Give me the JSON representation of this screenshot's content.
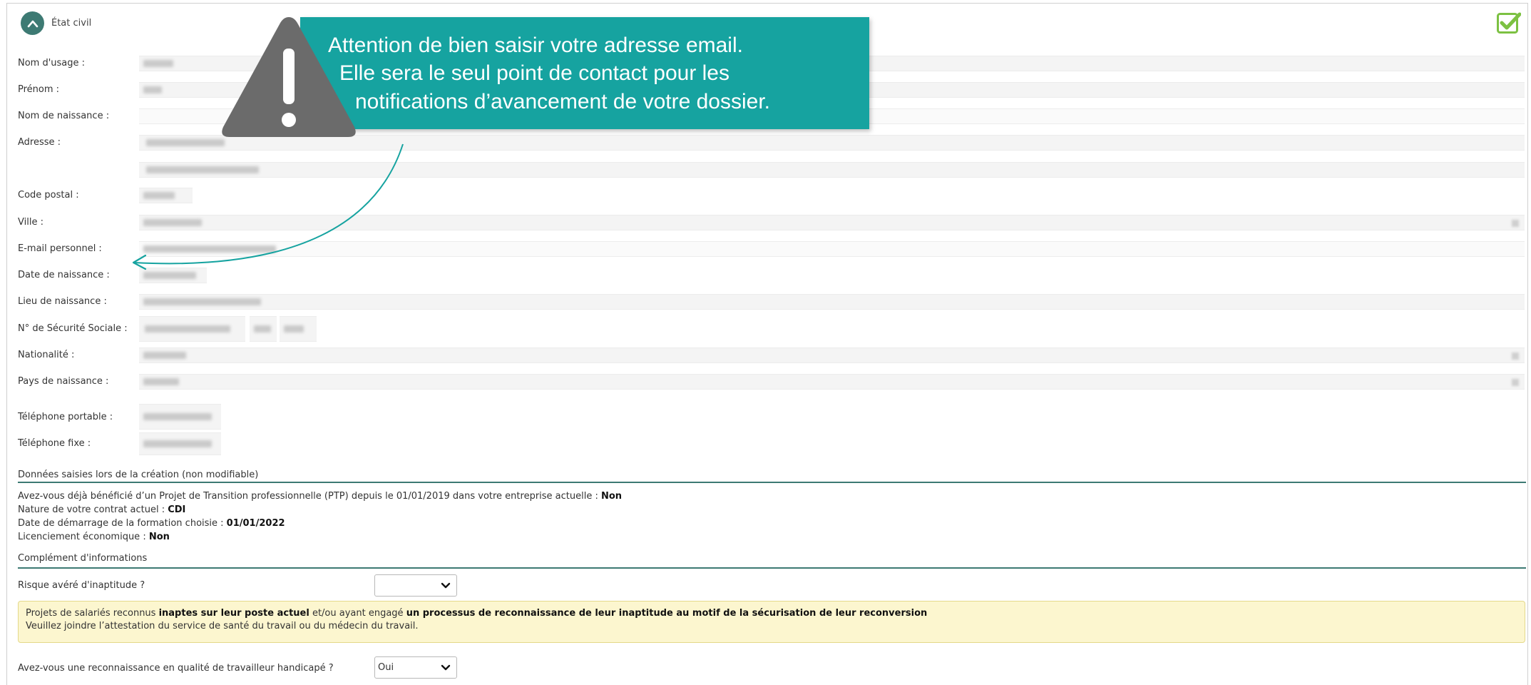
{
  "section": {
    "title": "État civil"
  },
  "labels": {
    "nom_usage": "Nom d'usage :",
    "prenom": "Prénom :",
    "nom_naissance": "Nom de naissance :",
    "adresse": "Adresse :",
    "code_postal": "Code postal :",
    "ville": "Ville :",
    "email": "E-mail personnel :",
    "date_naissance": "Date de naissance :",
    "lieu_naissance": "Lieu de naissance :",
    "secu": "N° de Sécurité Sociale :",
    "nationalite": "Nationalité :",
    "pays_naissance": "Pays de naissance :",
    "tel_portable": "Téléphone portable :",
    "tel_fixe": "Téléphone fixe :"
  },
  "creation": {
    "title": "Données saisies lors de la création (non modifiable)",
    "ptp_question": "Avez-vous déjà bénéficié d’un Projet de Transition professionnelle (PTP) depuis le 01/01/2019 dans votre entreprise actuelle : ",
    "ptp_value": "Non",
    "contrat_label": "Nature de votre contrat actuel : ",
    "contrat_value": "CDI",
    "date_label": "Date de démarrage de la formation choisie : ",
    "date_value": "01/01/2022",
    "licenciement_label": "Licenciement économique : ",
    "licenciement_value": "Non"
  },
  "complement": {
    "title": "Complément d'informations",
    "inaptitude_label": "Risque avéré d'inaptitude ?",
    "inaptitude_value": "",
    "notice_1a": "Projets de salariés reconnus ",
    "notice_1b": "inaptes sur leur poste actuel",
    "notice_1c": " et/ou ayant engagé ",
    "notice_1d": "un processus de reconnaissance de leur inaptitude au motif de la sécurisation de leur reconversion",
    "notice_2": "Veuillez joindre l’attestation du service de santé du travail ou du médecin du travail.",
    "handicap_label": "Avez-vous une reconnaissance en qualité de travailleur handicapé ?",
    "handicap_value": "Oui"
  },
  "callout": {
    "line1": "Attention de bien saisir votre adresse email.",
    "line2": "Elle sera le seul point de contact pour les",
    "line3": "notifications d’avancement de votre dossier."
  },
  "colors": {
    "accent": "#3d7a73",
    "callout_bg": "#16a3a0",
    "warning_triangle": "#6b6b6b",
    "check": "#7cc142",
    "notice_bg": "#fcf6cf"
  },
  "icons": [
    "chevron-up-icon",
    "checkmark-icon",
    "warning-icon",
    "chevron-down-icon",
    "arrow-icon"
  ]
}
